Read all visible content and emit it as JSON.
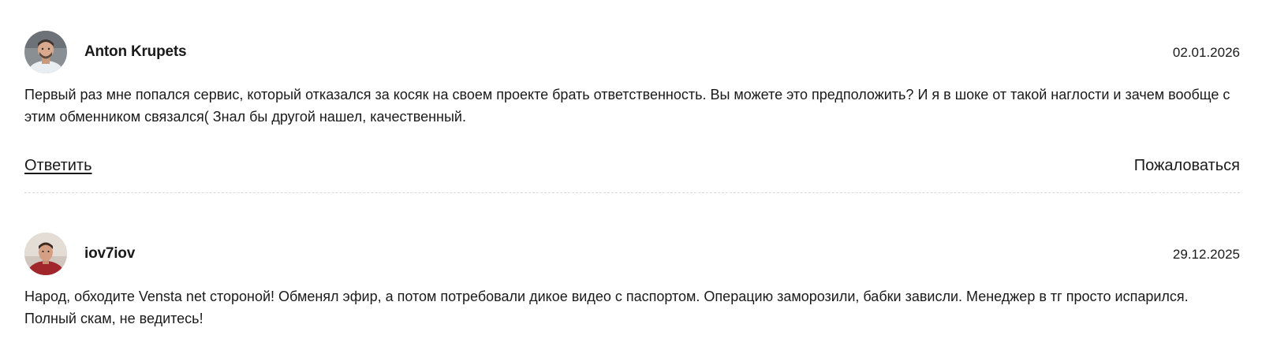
{
  "reviews": [
    {
      "author": "Anton Krupets",
      "date": "02.01.2026",
      "text": "Первый раз мне попался сервис, который отказался за косяк на своем проекте брать ответственность. Вы можете это предположить? И я в шоке от такой наглости и зачем вообще с этим обменником связался( Знал бы другой нашел, качественный.",
      "reply_label": "Ответить",
      "report_label": "Пожаловаться"
    },
    {
      "author": "iov7iov",
      "date": "29.12.2025",
      "text": "Народ, обходите Vensta net стороной! Обменял эфир, а потом потребовали дикое видео с паспортом. Операцию заморозили, бабки зависли. Менеджер в тг просто испарился. Полный скам, не ведитесь!"
    }
  ],
  "colors": {
    "text": "#1a1a1a",
    "divider": "#d9d9d9",
    "background": "#ffffff"
  },
  "icons": {
    "avatar_1": "user-photo-avatar",
    "avatar_2": "user-photo-avatar"
  }
}
